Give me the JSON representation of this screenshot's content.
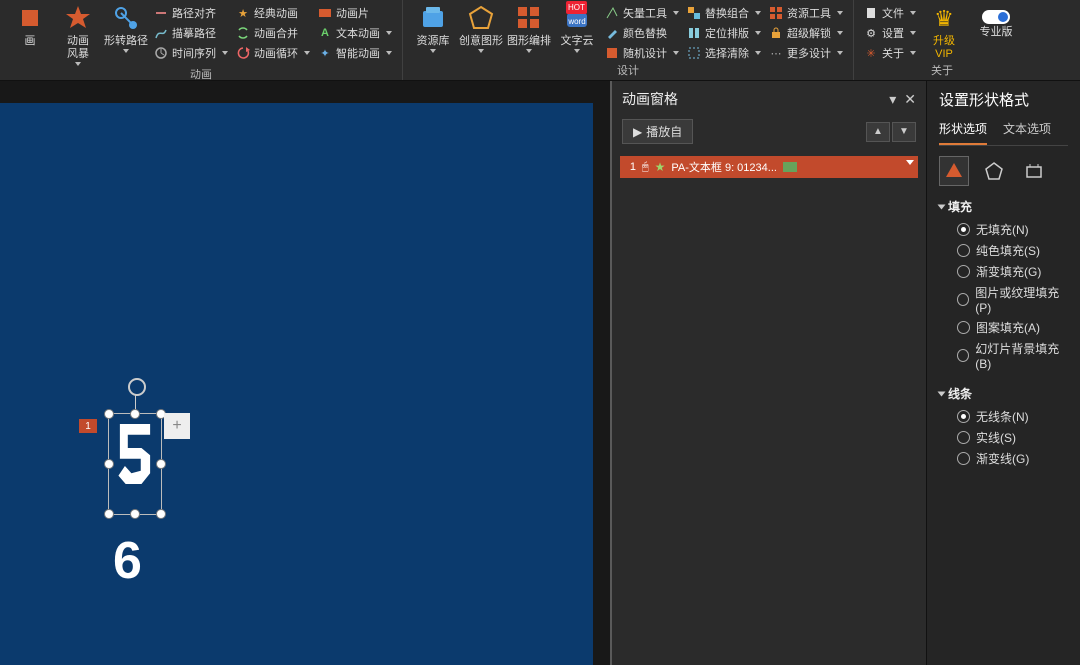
{
  "ribbon": {
    "groups": {
      "animation": {
        "label": "动画",
        "big": [
          {
            "label": "画"
          },
          {
            "label": "动画\n风暴"
          },
          {
            "label": "形转路径"
          }
        ],
        "col": [
          {
            "icon": "align",
            "label": "路径对齐"
          },
          {
            "icon": "scribble",
            "label": "描摹路径"
          },
          {
            "icon": "clock",
            "label": "时间序列"
          }
        ],
        "col2": [
          {
            "icon": "star-o",
            "label": "经典动画"
          },
          {
            "icon": "merge",
            "label": "动画合并"
          },
          {
            "icon": "loop",
            "label": "动画循环"
          }
        ],
        "col3": [
          {
            "icon": "film",
            "label": "动画片"
          },
          {
            "icon": "text-anim",
            "label": "文本动画"
          },
          {
            "icon": "smart",
            "label": "智能动画"
          }
        ]
      },
      "design": {
        "label": "设计",
        "big": [
          {
            "label": "资源库"
          },
          {
            "label": "创意图形"
          },
          {
            "label": "图形编排"
          },
          {
            "label": "文字云"
          }
        ],
        "col": [
          {
            "icon": "vector",
            "label": "矢量工具"
          },
          {
            "icon": "eyedrop",
            "label": "颜色替换"
          },
          {
            "icon": "random",
            "label": "随机设计"
          }
        ],
        "col2": [
          {
            "icon": "combo",
            "label": "替换组合"
          },
          {
            "icon": "layout",
            "label": "定位排版"
          },
          {
            "icon": "select",
            "label": "选择清除"
          }
        ],
        "col3": [
          {
            "icon": "res",
            "label": "资源工具"
          },
          {
            "icon": "super",
            "label": "超级解锁"
          },
          {
            "icon": "more",
            "label": "更多设计"
          }
        ]
      },
      "about": {
        "label": "关于",
        "col": [
          {
            "icon": "file",
            "label": "文件"
          },
          {
            "icon": "gear",
            "label": "设置"
          },
          {
            "icon": "about",
            "label": "关于"
          }
        ],
        "vip": "升级\nVIP",
        "pro": "专业版"
      }
    }
  },
  "canvas": {
    "anim_tag": "1",
    "digit": "6"
  },
  "anim_pane": {
    "title": "动画窗格",
    "play": "播放自",
    "item": {
      "index": "1",
      "name": "PA-文本框 9: 01234..."
    }
  },
  "format_pane": {
    "title": "设置形状格式",
    "tabs": {
      "shape": "形状选项",
      "text": "文本选项"
    },
    "sections": {
      "fill": {
        "title": "填充",
        "options": [
          {
            "label": "无填充(N)",
            "sel": true
          },
          {
            "label": "纯色填充(S)",
            "sel": false
          },
          {
            "label": "渐变填充(G)",
            "sel": false
          },
          {
            "label": "图片或纹理填充(P)",
            "sel": false
          },
          {
            "label": "图案填充(A)",
            "sel": false
          },
          {
            "label": "幻灯片背景填充(B)",
            "sel": false
          }
        ]
      },
      "line": {
        "title": "线条",
        "options": [
          {
            "label": "无线条(N)",
            "sel": true
          },
          {
            "label": "实线(S)",
            "sel": false
          },
          {
            "label": "渐变线(G)",
            "sel": false
          }
        ]
      }
    }
  }
}
